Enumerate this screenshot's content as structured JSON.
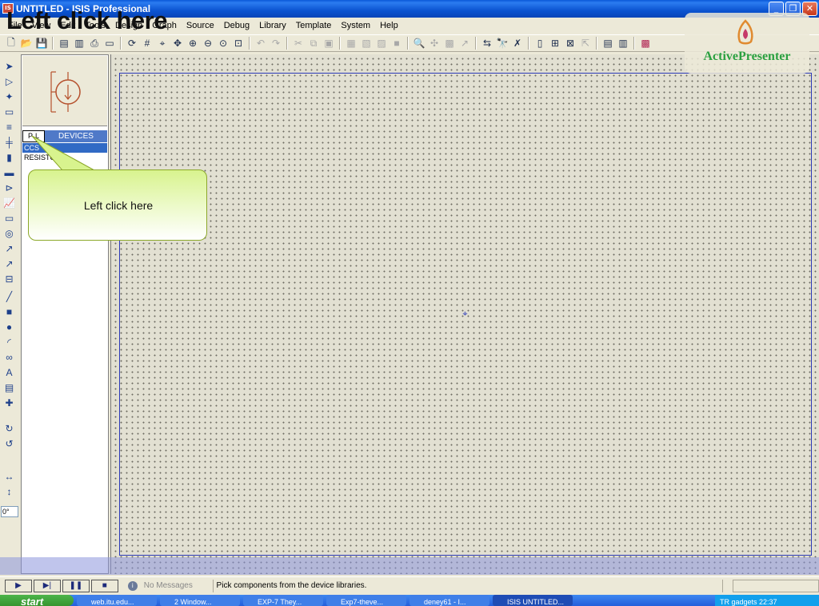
{
  "window": {
    "title": "UNTITLED - ISIS Professional",
    "minimize": "_",
    "maximize": "❐",
    "close": "✕"
  },
  "overlay_caption": "Left click here",
  "menu": [
    "File",
    "View",
    "Edit",
    "Tools",
    "Design",
    "Graph",
    "Source",
    "Debug",
    "Library",
    "Template",
    "System",
    "Help"
  ],
  "logo": {
    "text": "ActivePresenter"
  },
  "object_selector": {
    "p_button": "P",
    "l_button": "L",
    "tab_label": "DEVICES",
    "devices": [
      "CCS",
      "RESISTOR"
    ],
    "selected_index": 0
  },
  "angle_value": "0°",
  "callout": {
    "text": "Left click here"
  },
  "status": {
    "message_count": "No Messages",
    "hint": "Pick components from the device libraries."
  },
  "taskbar": {
    "start": "start",
    "tasks": [
      "web.itu.edu...",
      "2 Window...",
      "EXP-7 They...",
      "Exp7-theve...",
      "deney61 - I...",
      "ISIS UNTITLED..."
    ],
    "tray_text": "TR  gadgets  22:37"
  }
}
